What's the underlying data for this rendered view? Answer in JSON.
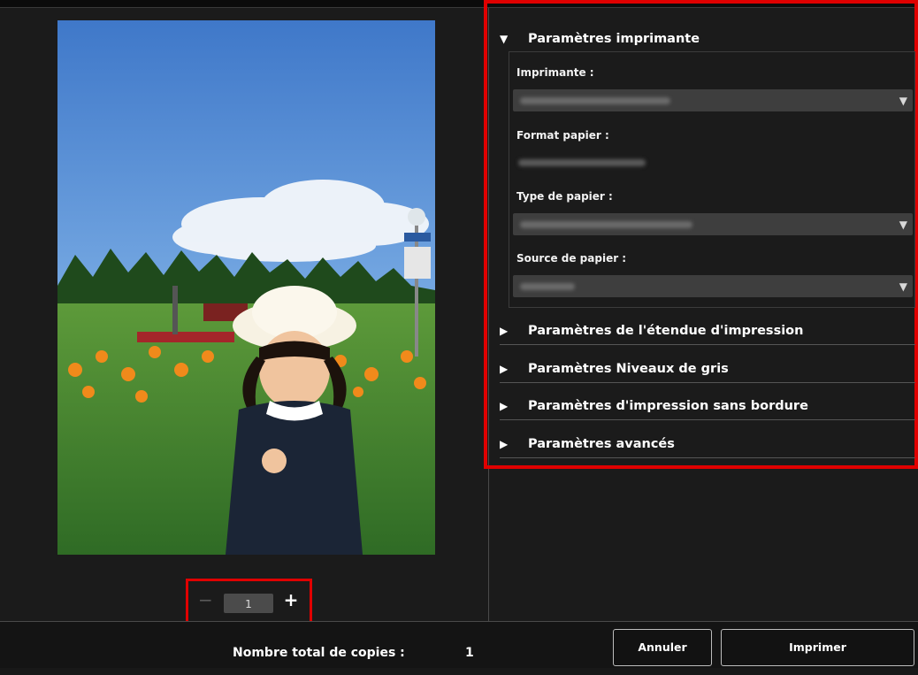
{
  "settings": {
    "printer_section": {
      "title": "Paramètres imprimante",
      "printer_label": "Imprimante :",
      "paper_size_label": "Format papier :",
      "paper_type_label": "Type de papier :",
      "paper_source_label": "Source de papier :"
    },
    "collapsed_sections": [
      "Paramètres de l'étendue d'impression",
      "Paramètres Niveaux de gris",
      "Paramètres d'impression sans bordure",
      "Paramètres avancés"
    ]
  },
  "copies": {
    "value": "1",
    "minus_symbol": "−",
    "plus_symbol": "+"
  },
  "footer": {
    "total_copies_label": "Nombre total de copies :",
    "total_copies_value": "1",
    "cancel_label": "Annuler",
    "print_label": "Imprimer"
  },
  "icons": {
    "expanded": "triangle-down-icon",
    "collapsed": "triangle-right-icon",
    "dropdown": "dropdown-arrow-icon"
  },
  "colors": {
    "highlight": "#e00000",
    "background": "#1b1b1b"
  }
}
